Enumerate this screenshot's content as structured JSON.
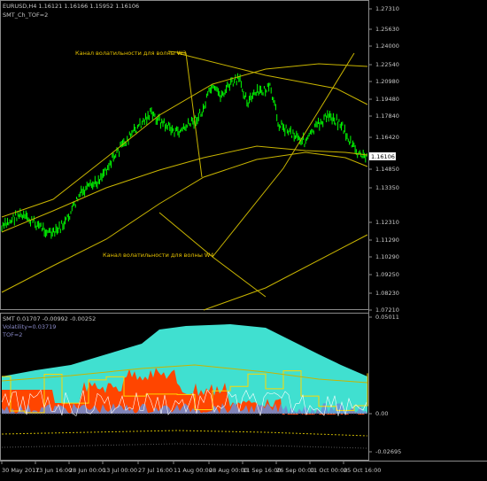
{
  "main": {
    "header": "EURUSD,H4  1.16121 1.16166 1.15952 1.16106",
    "subindicator": "SMT_Ch_TOF=2",
    "annotation_w3": "Канал волатильности для волны W3",
    "annotation_w4": "Канал волатильности для волны W4",
    "current_price": "1.16106",
    "price_ticks": [
      "1.27310",
      "1.25630",
      "1.24000",
      "1.22540",
      "1.20980",
      "1.19480",
      "1.17840",
      "1.16420",
      "1.14850",
      "1.13350",
      "1.12310",
      "1.11290",
      "1.10290",
      "1.09250",
      "1.08230",
      "1.07210"
    ]
  },
  "indicator": {
    "header": "SMT 0.01707 -0.00992 -0.00252",
    "volatility": "Volatility=0.03719",
    "tof": "TOF=2",
    "ticks": [
      "0.05011",
      "0.00",
      "-0.02695"
    ]
  },
  "time_axis": [
    "30 May 2017",
    "13 Jun 16:00",
    "28 Jun 00:00",
    "13 Jul 00:00",
    "27 Jul 16:00",
    "11 Aug 00:00",
    "28 Aug 00:00",
    "11 Sep 16:00",
    "26 Sep 00:00",
    "11 Oct 00:00",
    "25 Oct 16:00"
  ],
  "colors": {
    "price": "#00ff00",
    "channel": "#c8b400",
    "cyan_fill": "#40e0d0",
    "orange_fill": "#ff4500",
    "blue_fill": "#6a8fd8",
    "yellow_line": "#ffd700"
  }
}
